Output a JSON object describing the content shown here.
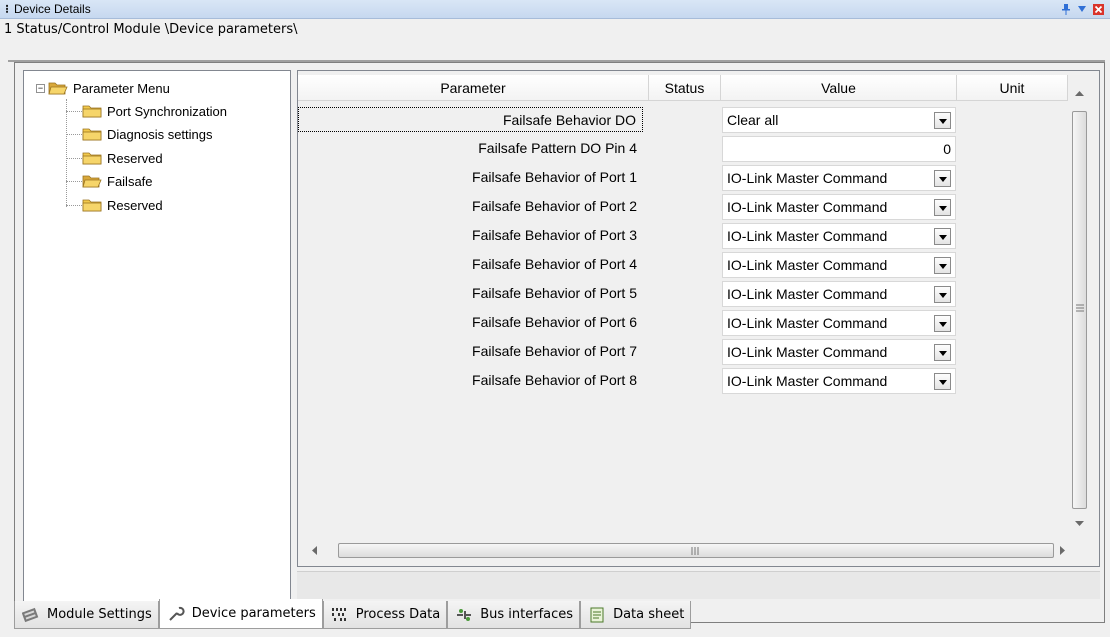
{
  "window": {
    "title": "Device Details",
    "breadcrumb": "1 Status/Control Module \\Device parameters\\"
  },
  "tree": {
    "root": "Parameter Menu",
    "items": [
      {
        "label": "Port Synchronization"
      },
      {
        "label": "Diagnosis settings"
      },
      {
        "label": "Reserved"
      },
      {
        "label": "Failsafe"
      },
      {
        "label": "Reserved"
      }
    ]
  },
  "grid": {
    "columns": [
      "Parameter",
      "Status",
      "Value",
      "Unit"
    ],
    "rows": [
      {
        "param": "Failsafe Behavior DO",
        "value": "Clear all",
        "type": "dropdown"
      },
      {
        "param": "Failsafe Pattern DO Pin 4",
        "value": "0",
        "type": "number"
      },
      {
        "param": "Failsafe Behavior of Port 1",
        "value": "IO-Link Master Command",
        "type": "dropdown"
      },
      {
        "param": "Failsafe Behavior of Port 2",
        "value": "IO-Link Master Command",
        "type": "dropdown"
      },
      {
        "param": "Failsafe Behavior of Port 3",
        "value": "IO-Link Master Command",
        "type": "dropdown"
      },
      {
        "param": "Failsafe Behavior of Port 4",
        "value": "IO-Link Master Command",
        "type": "dropdown"
      },
      {
        "param": "Failsafe Behavior of Port 5",
        "value": "IO-Link Master Command",
        "type": "dropdown"
      },
      {
        "param": "Failsafe Behavior of Port 6",
        "value": "IO-Link Master Command",
        "type": "dropdown"
      },
      {
        "param": "Failsafe Behavior of Port 7",
        "value": "IO-Link Master Command",
        "type": "dropdown"
      },
      {
        "param": "Failsafe Behavior of Port 8",
        "value": "IO-Link Master Command",
        "type": "dropdown"
      }
    ]
  },
  "tabs": [
    {
      "label": "Module Settings",
      "icon": "module-settings-icon"
    },
    {
      "label": "Device parameters",
      "icon": "wrench-icon",
      "active": true
    },
    {
      "label": "Process Data",
      "icon": "binary-data-icon"
    },
    {
      "label": "Bus interfaces",
      "icon": "bus-interfaces-icon"
    },
    {
      "label": "Data sheet",
      "icon": "data-sheet-icon"
    }
  ],
  "colors": {
    "title_bg": "#c6d8ef",
    "folder": "#f2c94c",
    "close": "#d9342b",
    "pin": "#2f6fd6"
  }
}
